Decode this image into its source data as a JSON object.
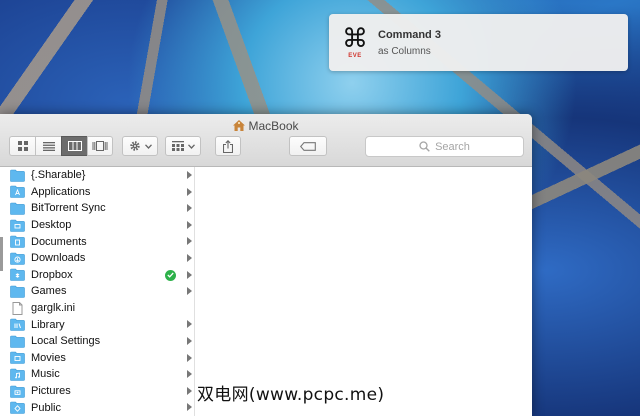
{
  "notification": {
    "title": "Command 3",
    "subtitle": "as Columns",
    "icon": "command-key-icon",
    "icon_glyph": "⌘",
    "icon_caption": "EVE"
  },
  "window": {
    "title": "MacBook",
    "title_icon": "home-icon"
  },
  "toolbar": {
    "view_modes": [
      {
        "name": "icon-view",
        "active": false
      },
      {
        "name": "list-view",
        "active": false
      },
      {
        "name": "column-view",
        "active": true
      },
      {
        "name": "cover-flow-view",
        "active": false
      }
    ],
    "action_menu": "gear-icon",
    "arrange_menu": "grid-icon",
    "share": "share-icon",
    "tags": "tag-icon",
    "search_placeholder": "Search"
  },
  "files": [
    {
      "name": "{.Sharable}",
      "type": "folder",
      "arrow": true
    },
    {
      "name": "Applications",
      "type": "apps-folder",
      "arrow": true
    },
    {
      "name": "BitTorrent Sync",
      "type": "folder",
      "arrow": true
    },
    {
      "name": "Desktop",
      "type": "desktop-folder",
      "arrow": true
    },
    {
      "name": "Documents",
      "type": "docs-folder",
      "arrow": true
    },
    {
      "name": "Downloads",
      "type": "downloads-folder",
      "arrow": true
    },
    {
      "name": "Dropbox",
      "type": "dropbox-folder",
      "arrow": true,
      "synced": true
    },
    {
      "name": "Games",
      "type": "folder",
      "arrow": true
    },
    {
      "name": "garglk.ini",
      "type": "file",
      "arrow": false
    },
    {
      "name": "Library",
      "type": "library-folder",
      "arrow": true
    },
    {
      "name": "Local Settings",
      "type": "folder",
      "arrow": true
    },
    {
      "name": "Movies",
      "type": "movies-folder",
      "arrow": true
    },
    {
      "name": "Music",
      "type": "music-folder",
      "arrow": true
    },
    {
      "name": "Pictures",
      "type": "pictures-folder",
      "arrow": true
    },
    {
      "name": "Public",
      "type": "public-folder",
      "arrow": true
    }
  ],
  "watermark": "双电网(www.pcpc.me)",
  "colors": {
    "folder": "#5eb8ef",
    "sync_badge": "#2db14a",
    "active_view": "#6c6c6c"
  }
}
